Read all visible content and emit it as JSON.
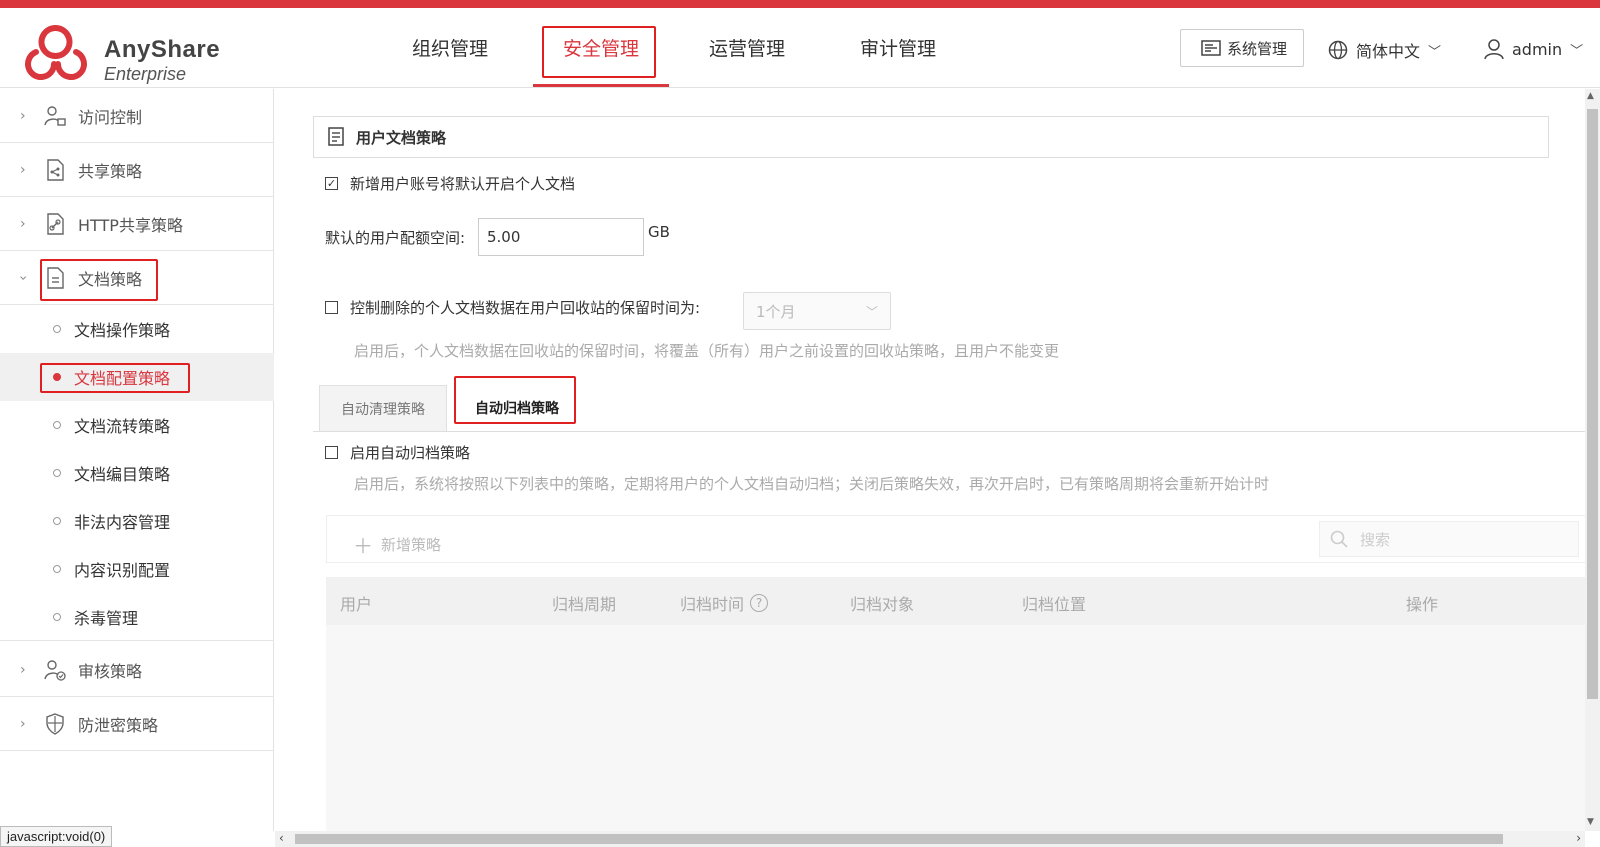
{
  "brand": {
    "name": "AnyShare",
    "edition": "Enterprise",
    "accent": "#d9363e"
  },
  "top_nav": {
    "items": [
      {
        "label": "组织管理"
      },
      {
        "label": "安全管理",
        "active": true
      },
      {
        "label": "运营管理"
      },
      {
        "label": "审计管理"
      }
    ],
    "system_button": "系统管理",
    "language": "简体中文",
    "user": "admin"
  },
  "sidebar": {
    "items": [
      {
        "label": "访问控制",
        "icon": "user-lock-icon"
      },
      {
        "label": "共享策略",
        "icon": "share-doc-icon"
      },
      {
        "label": "HTTP共享策略",
        "icon": "link-doc-icon"
      },
      {
        "label": "文档策略",
        "icon": "document-icon",
        "expanded": true
      },
      {
        "label": "审核策略",
        "icon": "user-check-icon"
      },
      {
        "label": "防泄密策略",
        "icon": "shield-icon"
      }
    ],
    "sub_items": [
      {
        "label": "文档操作策略"
      },
      {
        "label": "文档配置策略",
        "active": true
      },
      {
        "label": "文档流转策略"
      },
      {
        "label": "文档编目策略"
      },
      {
        "label": "非法内容管理"
      },
      {
        "label": "内容识别配置"
      },
      {
        "label": "杀毒管理"
      }
    ]
  },
  "main": {
    "section_title": "用户文档策略",
    "auto_enable_label": "新增用户账号将默认开启个人文档",
    "auto_enable_checked": true,
    "quota_label": "默认的用户配额空间:",
    "quota_value": "5.00",
    "quota_unit": "GB",
    "retention_label": "控制删除的个人文档数据在用户回收站的保留时间为:",
    "retention_checked": false,
    "retention_value": "1个月",
    "retention_hint": "启用后，个人文档数据在回收站的保留时间，将覆盖（所有）用户之前设置的回收站策略，且用户不能变更",
    "tabs": [
      {
        "label": "自动清理策略"
      },
      {
        "label": "自动归档策略",
        "active": true
      }
    ],
    "archive_enable_label": "启用自动归档策略",
    "archive_enable_checked": false,
    "archive_hint": "启用后，系统将按照以下列表中的策略，定期将用户的个人文档自动归档；关闭后策略失效，再次开启时，已有策略周期将会重新开始计时",
    "add_button": "新增策略",
    "search_placeholder": "搜索",
    "table_columns": [
      "用户",
      "归档周期",
      "归档时间",
      "归档对象",
      "归档位置",
      "操作"
    ]
  },
  "status_bar": "javascript:void(0)"
}
